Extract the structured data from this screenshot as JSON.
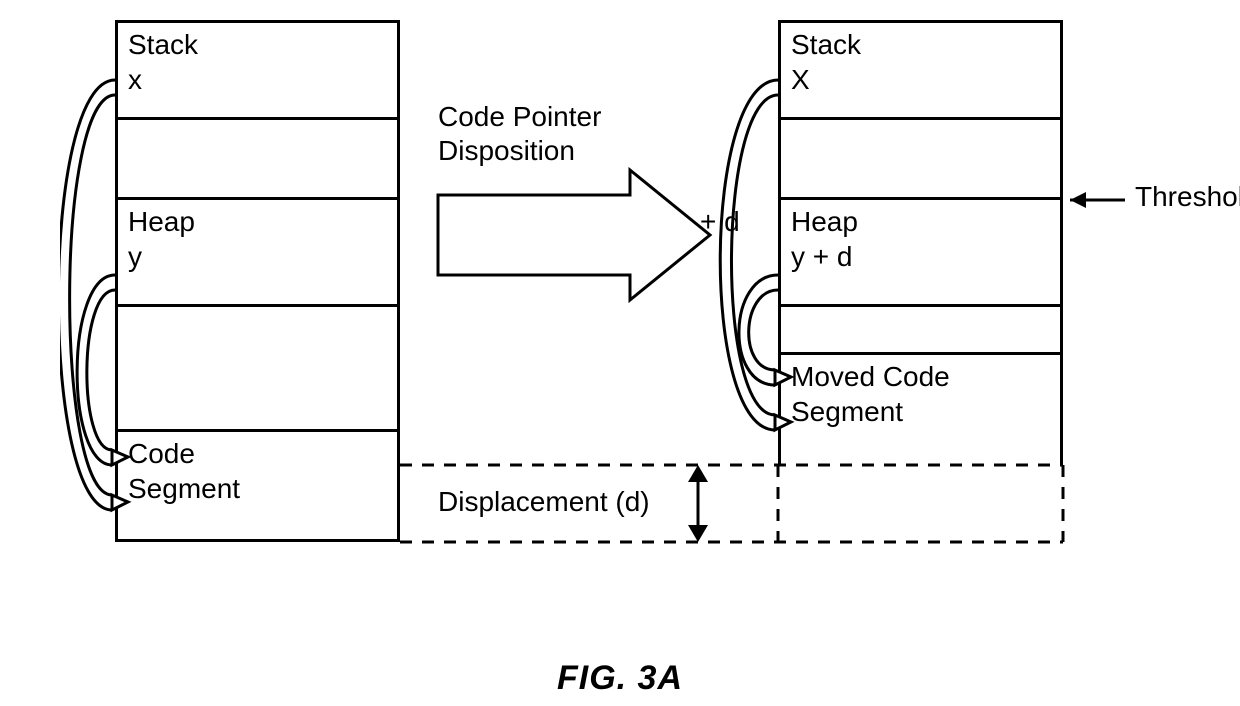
{
  "figure_label": "FIG. 3A",
  "labels": {
    "code_pointer": "Code Pointer\nDisposition",
    "threshold": "Threshold",
    "plus_d": "+ d",
    "displacement": "Displacement (d)"
  },
  "left": {
    "stack": "Stack\nx",
    "gap1": "",
    "heap": "Heap\ny",
    "gap2": "",
    "code": "Code\nSegment"
  },
  "right": {
    "stack": "Stack\nX",
    "gap1": "",
    "heap": "Heap\ny + d",
    "gap2": "",
    "moved_code": "Moved Code\nSegment"
  }
}
